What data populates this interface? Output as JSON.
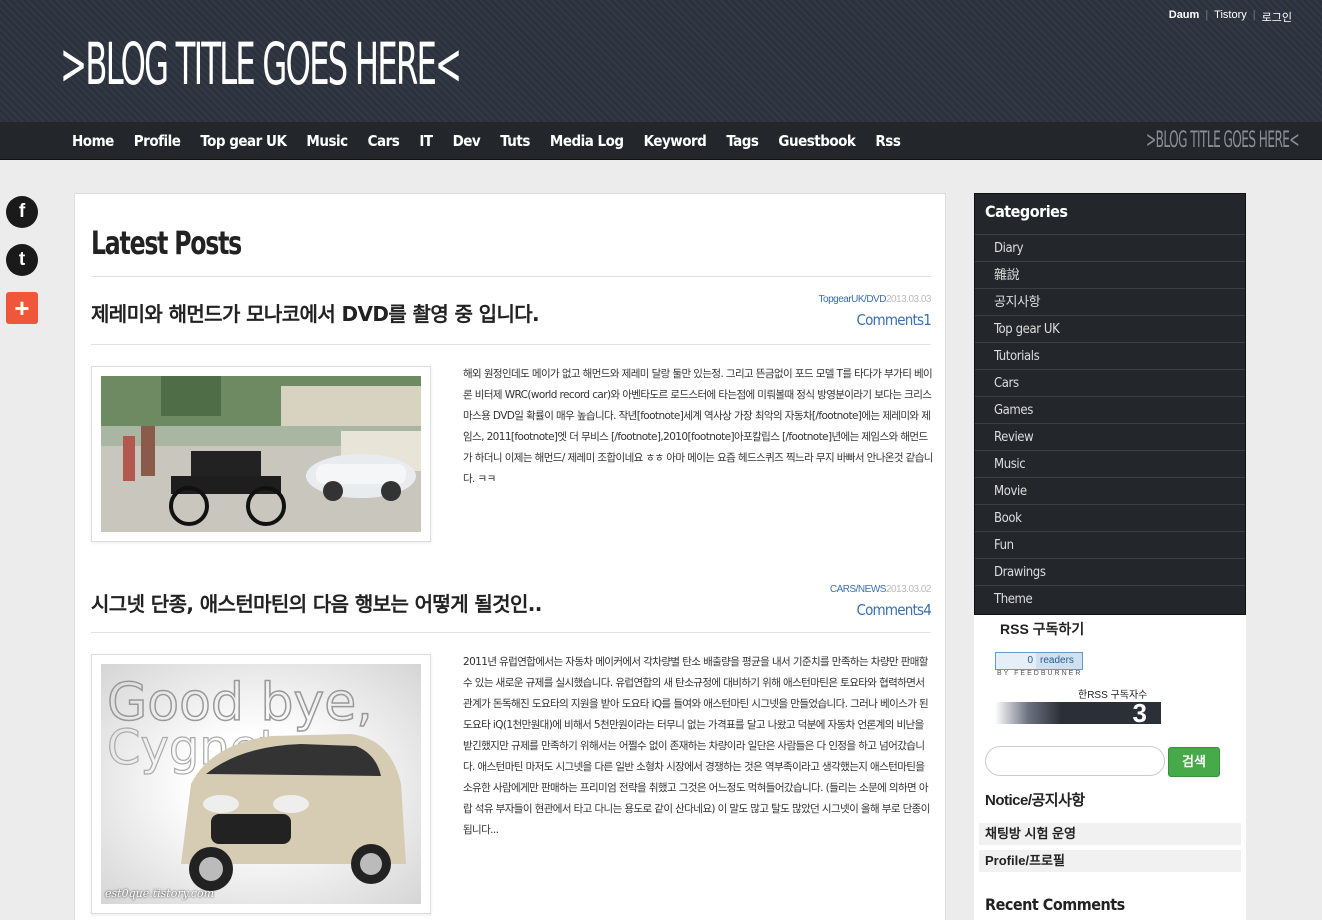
{
  "header": {
    "blog_title": ">BLOG TITLE GOES HERE<",
    "top_links": [
      {
        "label": "Daum"
      },
      {
        "label": "Tistory"
      },
      {
        "label": "로그인"
      }
    ]
  },
  "nav": {
    "items": [
      "Home",
      "Profile",
      "Top gear UK",
      "Music",
      "Cars",
      "IT",
      "Dev",
      "Tuts",
      "Media Log",
      "Keyword",
      "Tags",
      "Guestbook",
      "Rss"
    ],
    "logo": ">BLOG TITLE GOES HERE<"
  },
  "social": {
    "facebook": "f",
    "twitter": "t",
    "share": "+"
  },
  "main": {
    "section_title": "Latest Posts",
    "posts": [
      {
        "title": "제레미와 해먼드가 모나코에서 DVD를 촬영 중 입니다.",
        "category": "TopgearUK/DVD",
        "date": "2013.03.03",
        "comments": "Comments1",
        "excerpt": "해외 원정인데도 메이가 없고 해먼드와 제레미 달랑 둘만 있는정. 그리고 뜬금없이 포드 모델 T를 타다가 부가티 베이론 비터제 WRC(world record car)와 아벤타도르 로드스터에 타는점에 미뤄볼때 정식 방영분이라기 보다는 크리스마스용 DVD일 확률이 매우 높습니다. 작년[footnote]세계 역사상 가장 최악의 자동차[/footnote]에는 제레미와 제임스, 2011[footnote]엣 더 무비스 [/footnote],2010[footnote]아포칼립스 [/footnote]년에는 제임스와 해먼드가 하더니 이제는 해먼드/ 제레미 조합이네요 ㅎㅎ 아마 메이는 요즘 헤드스퀴즈 찍느라 무지 바빠서 안나온것 같습니다. ㅋㅋ"
      },
      {
        "title": "시그넷 단종, 애스턴마틴의 다음 행보는 어떻게 될것인..",
        "category": "CARS/NEWS",
        "date": "2013.03.02",
        "comments": "Comments4",
        "excerpt": "2011년 유럽연합에서는 자동차 메이커에서 각차량별 탄소 배출량을 평균을 내서 기준치를 만족하는 차량만 판매할수 있는 새로운 규제를 실시했습니다. 유럽연합의 새 탄소규정에 대비하기 위해 애스턴마틴은 토요타와 협력하면서 관계가 돈독해진 도요타의 지원을 받아 도요타 iQ를 들여와 애스턴마틴 시그넷을 만들었습니다. 그러나 베이스가 된 도요타 iQ(1천만원대)에 비해서 5천만원이라는 터무니 없는 가격표를 달고 나왔고 덕분에 자동차 언론계의 비난을 받긴했지만 규제를 만족하기 위해서는 어쩔수 없이 존재하는 차량이라 일단은 사람들은 다 인정을 하고 넘어갔습니다. 애스턴마틴 마저도 시그넷을 다른 일반 소형차 시장에서 경쟁하는 것은 역부족이라고 생각했는지 애스턴마틴을 소유한 사람에게만 판매하는 프리미엄 전략을 취했고 그것은 어느정도 먹혀들어갔습니다. (들리는 소문에 의하면 아랍 석유 부자들이 현관에서 타고 다니는 용도로 같이 산다네요) 이 말도 많고 탈도 많았던 시그넷이 올해 부로 단종이 됩니다..."
      }
    ],
    "image_watermark_text": "Good bye, Cygnet",
    "image_credit": "est0que.tistory.com"
  },
  "sidebar": {
    "categories_title": "Categories",
    "categories": [
      "Diary",
      "雜說",
      "공지사항",
      "Top gear UK",
      "Tutorials",
      "Cars",
      "Games",
      "Review",
      "Music",
      "Movie",
      "Book",
      "Fun",
      "Drawings",
      "Theme"
    ],
    "rss_label": "RSS 구독하기",
    "feedburner_count": "0",
    "feedburner_unit": "readers",
    "feedburner_by": "BY FEEDBURNER",
    "subscriber_label": "한RSS 구독자수",
    "subscriber_count": "3",
    "search_placeholder": "",
    "search_button": "검색",
    "notice_title": "Notice/공지사항",
    "notices": [
      "채팅방 시험 운영",
      "Profile/프로필"
    ],
    "recent_comments_title": "Recent Comments"
  }
}
